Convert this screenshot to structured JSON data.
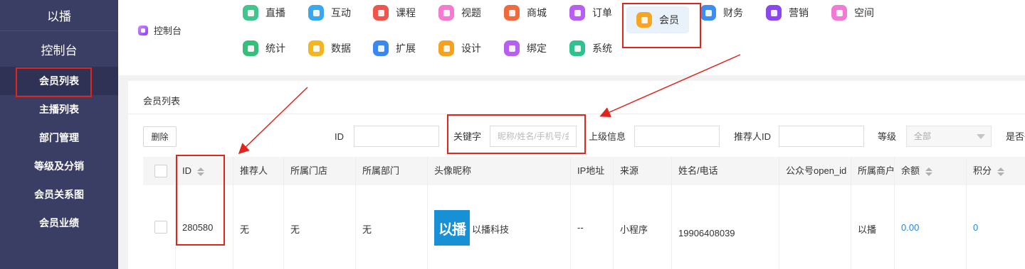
{
  "sidebar": {
    "brand": "以播",
    "console": "控制台",
    "items": [
      {
        "label": "会员列表"
      },
      {
        "label": "主播列表"
      },
      {
        "label": "部门管理"
      },
      {
        "label": "等级及分销"
      },
      {
        "label": "会员关系图"
      },
      {
        "label": "会员业绩"
      }
    ]
  },
  "topnav": {
    "console_label": "控制台",
    "items": [
      {
        "label": "直播",
        "icon": "live-icon",
        "color": "#41c58f"
      },
      {
        "label": "互动",
        "icon": "chat-icon",
        "color": "#39a8f0"
      },
      {
        "label": "课程",
        "icon": "book-icon",
        "color": "#f0554c"
      },
      {
        "label": "视题",
        "icon": "video-icon",
        "color": "#f47bd0"
      },
      {
        "label": "商城",
        "icon": "shop-icon",
        "color": "#f26a3b"
      },
      {
        "label": "订单",
        "icon": "order-icon",
        "color": "#b65ff0"
      },
      {
        "label": "会员",
        "icon": "member-icon",
        "color": "#f6a623"
      },
      {
        "label": "财务",
        "icon": "finance-icon",
        "color": "#3c8ff0"
      },
      {
        "label": "营销",
        "icon": "marketing-icon",
        "color": "#8a47f0"
      },
      {
        "label": "空间",
        "icon": "space-icon",
        "color": "#f27ad3"
      },
      {
        "label": "统计",
        "icon": "stats-icon",
        "color": "#34c07b"
      },
      {
        "label": "数据",
        "icon": "data-icon",
        "color": "#f5b51f"
      },
      {
        "label": "扩展",
        "icon": "extend-icon",
        "color": "#3b87f2"
      },
      {
        "label": "设计",
        "icon": "design-icon",
        "color": "#f7a21c"
      },
      {
        "label": "绑定",
        "icon": "link-icon",
        "color": "#b65ff0"
      },
      {
        "label": "系统",
        "icon": "system-icon",
        "color": "#2fc28f"
      }
    ]
  },
  "panel": {
    "title": "会员列表",
    "delete_label": "删除",
    "filters": {
      "id_label": "ID",
      "keyword_label": "关键字",
      "keyword_placeholder": "昵称/姓名/手机号/会",
      "parent_label": "上级信息",
      "referrer_label": "推荐人ID",
      "level_label": "等级",
      "level_value": "全部",
      "more_label": "是否役"
    }
  },
  "table": {
    "columns": [
      "ID",
      "推荐人",
      "所属门店",
      "所属部门",
      "头像昵称",
      "IP地址",
      "来源",
      "姓名/电话",
      "公众号open_id",
      "所属商户",
      "余额",
      "积分"
    ],
    "rows": [
      {
        "id": "280580",
        "referrer": "无",
        "store": "无",
        "department": "无",
        "avatar_text": "以播",
        "nickname": "以播科技",
        "ip": "--",
        "source": "小程序",
        "phone": "19906408039",
        "openid": "",
        "merchant": "以播",
        "balance": "0.00",
        "points": "0"
      }
    ]
  },
  "colors": {
    "sidebar_bg": "#3a3d64",
    "annotation_red": "#e0251c",
    "link_blue": "#1e88e5"
  }
}
